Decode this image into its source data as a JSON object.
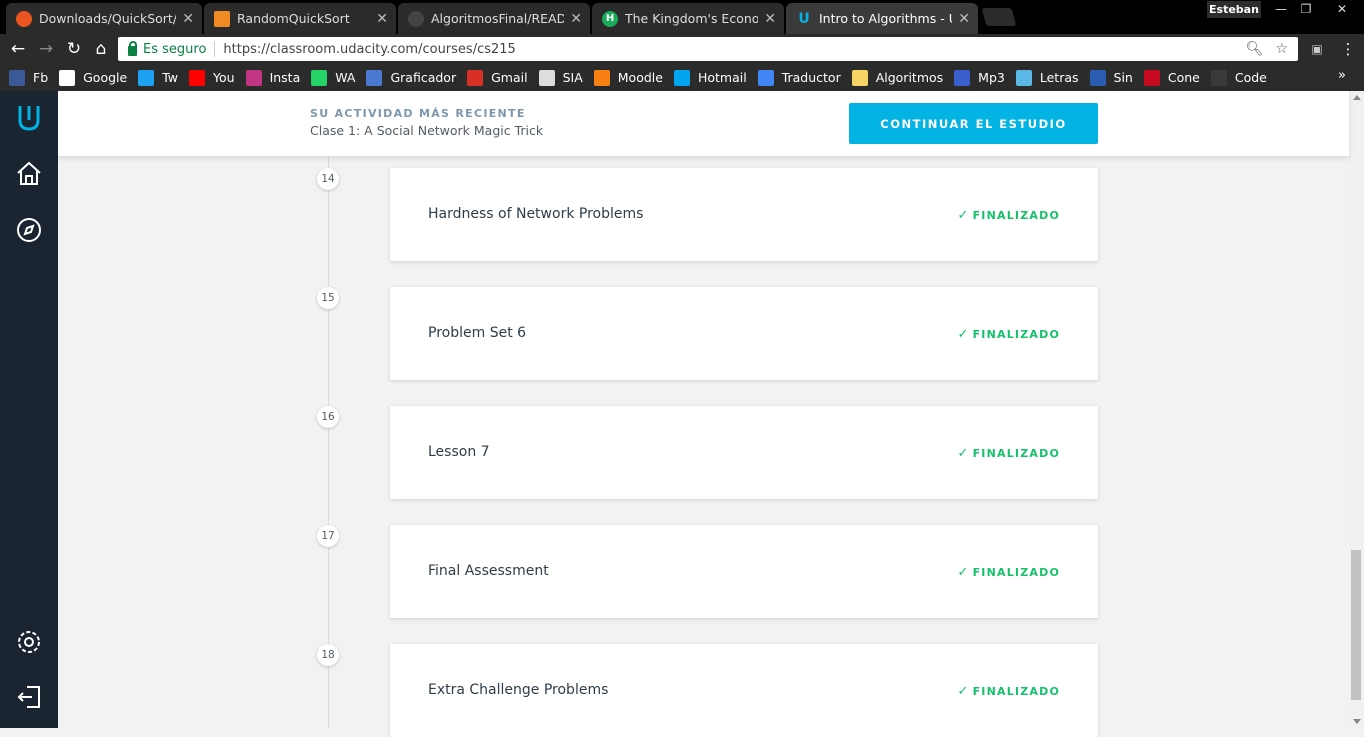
{
  "browser": {
    "tabs": [
      {
        "label": "Downloads/QuickSort/",
        "icon": "ubuntu-icon",
        "icon_color": "#e95420",
        "active": false
      },
      {
        "label": "RandomQuickSort",
        "icon": "book-icon",
        "icon_color": "#f08a24",
        "active": false
      },
      {
        "label": "AlgoritmosFinal/READMI",
        "icon": "github-icon",
        "icon_color": "#444444",
        "active": false
      },
      {
        "label": "The Kingdom's Economy",
        "icon": "h-icon",
        "icon_color": "#1aab5a",
        "active": false
      },
      {
        "label": "Intro to Algorithms - Uda",
        "icon": "udacity-icon",
        "icon_color": "#02b3e4",
        "active": true
      }
    ],
    "user": "Esteban",
    "secure_label": "Es seguro",
    "url": "https://classroom.udacity.com/courses/cs215",
    "bookmarks": [
      {
        "label": "Fb",
        "icon": "facebook-icon",
        "color": "#3b5998"
      },
      {
        "label": "Google",
        "icon": "google-icon",
        "color": "#ffffff"
      },
      {
        "label": "Tw",
        "icon": "twitter-icon",
        "color": "#1da1f2"
      },
      {
        "label": "You",
        "icon": "youtube-icon",
        "color": "#ff0000"
      },
      {
        "label": "Insta",
        "icon": "instagram-icon",
        "color": "#c13584"
      },
      {
        "label": "WA",
        "icon": "whatsapp-icon",
        "color": "#25d366"
      },
      {
        "label": "Graficador",
        "icon": "graph-icon",
        "color": "#4a7bd0"
      },
      {
        "label": "Gmail",
        "icon": "gmail-icon",
        "color": "#d93025"
      },
      {
        "label": "SIA",
        "icon": "document-icon",
        "color": "#dddddd"
      },
      {
        "label": "Moodle",
        "icon": "moodle-icon",
        "color": "#f98012"
      },
      {
        "label": "Hotmail",
        "icon": "windows-icon",
        "color": "#00a4ef"
      },
      {
        "label": "Traductor",
        "icon": "translate-icon",
        "color": "#4285f4"
      },
      {
        "label": "Algoritmos",
        "icon": "note-icon",
        "color": "#f6d365"
      },
      {
        "label": "Mp3",
        "icon": "music-icon",
        "color": "#3a5fcd"
      },
      {
        "label": "Letras",
        "icon": "lyrics-icon",
        "color": "#5cb8e6"
      },
      {
        "label": "Sin",
        "icon": "wordreference-icon",
        "color": "#2a5db0"
      },
      {
        "label": "Cone",
        "icon": "spain-flag-icon",
        "color": "#c60b1e"
      },
      {
        "label": "Code",
        "icon": "code-icon",
        "color": "#3a3a3a"
      }
    ]
  },
  "banner": {
    "heading": "SU ACTIVIDAD MÁS RECIENTE",
    "recent": "Clase 1: A Social Network Magic Trick",
    "button": "CONTINUAR EL ESTUDIO"
  },
  "lessons": [
    {
      "number": "14",
      "title": "Hardness of Network Problems",
      "status": "FINALIZADO"
    },
    {
      "number": "15",
      "title": "Problem Set 6",
      "status": "FINALIZADO"
    },
    {
      "number": "16",
      "title": "Lesson 7",
      "status": "FINALIZADO"
    },
    {
      "number": "17",
      "title": "Final Assessment",
      "status": "FINALIZADO"
    },
    {
      "number": "18",
      "title": "Extra Challenge Problems",
      "status": "FINALIZADO"
    }
  ],
  "colors": {
    "accent": "#02b3e4",
    "sidebar": "#1b2532",
    "success": "#15c26b"
  }
}
